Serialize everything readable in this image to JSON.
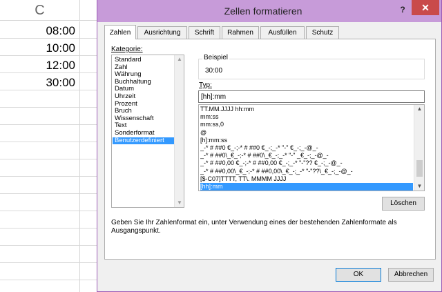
{
  "sheet": {
    "column_header": "C",
    "cells": [
      "08:00",
      "10:00",
      "12:00",
      "30:00"
    ]
  },
  "dialog": {
    "title": "Zellen formatieren",
    "help": "?",
    "close": "✕",
    "tabs": [
      "Zahlen",
      "Ausrichtung",
      "Schrift",
      "Rahmen",
      "Ausfüllen",
      "Schutz"
    ],
    "kategorie_label": "Kategorie:",
    "categories": [
      "Standard",
      "Zahl",
      "Währung",
      "Buchhaltung",
      "Datum",
      "Uhrzeit",
      "Prozent",
      "Bruch",
      "Wissenschaft",
      "Text",
      "Sonderformat",
      "Benutzerdefiniert"
    ],
    "selected_category": "Benutzerdefiniert",
    "beispiel_label": "Beispiel",
    "sample_value": "30:00",
    "typ_label": "Typ:",
    "typ_value": "[hh]:mm",
    "formats": [
      "TT.MM.JJJJ hh:mm",
      "mm:ss",
      "mm:ss,0",
      "@",
      "[h]:mm:ss",
      "_-* # ##0 €_-;-* # ##0 €_-;_-* \"-\" €_-;_-@_-",
      "_-* # ##0\\_€_-;-* # ##0\\_€_-;_-* \"-\" _€_-;_-@_-",
      "_-* # ##0,00 €_-;-* # ##0,00 €_-;_-* \"-\"?? €_-;_-@_-",
      "_-* # ##0,00\\_€_-;-* # ##0,00\\_€_-;_-* \"-\"??\\_€_-;_-@_-",
      "[$-C07]TTTT, TT\\. MMMM JJJJ",
      "[hh]:mm"
    ],
    "selected_format": "[hh]:mm",
    "delete_button": "Löschen",
    "hint": "Geben Sie Ihr Zahlenformat ein, unter Verwendung eines der bestehenden Zahlenformate als Ausgangspunkt.",
    "ok_button": "OK",
    "cancel_button": "Abbrechen"
  },
  "colors": {
    "titlebar": "#c79bd9",
    "close": "#c94a4a",
    "selection": "#3399ff"
  }
}
